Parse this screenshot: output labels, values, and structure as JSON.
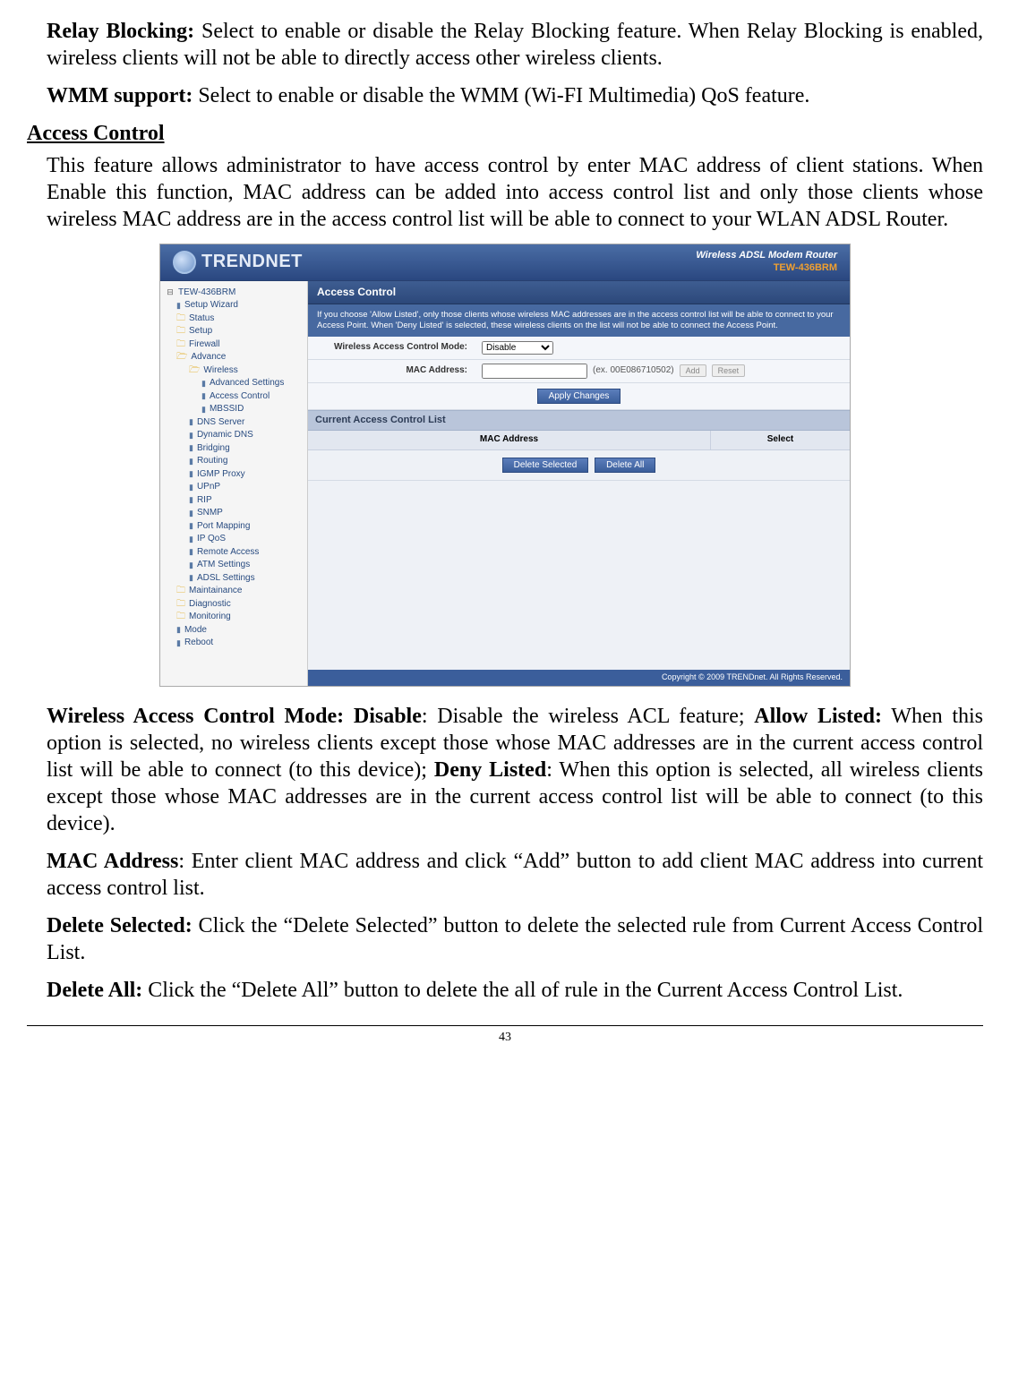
{
  "paragraphs": {
    "relay_label": "Relay Blocking:",
    "relay_text": " Select to enable or disable the Relay Blocking feature. When Relay Blocking is enabled, wireless clients will not be able to directly access other wireless clients.",
    "wmm_label": "WMM support:",
    "wmm_text": " Select to enable or disable the WMM (Wi-FI Multimedia) QoS feature.",
    "section_heading": "Access Control",
    "ac_intro": "This feature allows administrator to have access control by enter MAC address of client stations. When Enable this function, MAC address can be added into access control list and only those clients whose wireless MAC address are in the access control list will be able to connect to your WLAN ADSL Router.",
    "mode_label1": "Wireless Access Control Mode: Disable",
    "mode_text1": ": Disable the wireless ACL feature; ",
    "mode_label2": "Allow Listed:",
    "mode_text2": " When this option is selected, no wireless clients except those whose MAC addresses are in the current access control list will be able to connect (to this device); ",
    "mode_label3": "Deny Listed",
    "mode_text3": ": When this option is selected, all wireless clients except those whose MAC addresses are in the current access control list will be able to connect (to this device).",
    "maca_label": "MAC Address",
    "maca_text": ": Enter client MAC address and click “Add” button to add client MAC address into current access control list.",
    "ds_label": "Delete Selected:",
    "ds_text": " Click the “Delete Selected” button to delete the selected rule from Current Access Control List.",
    "da_label": "Delete All:",
    "da_text": " Click the “Delete All” button to delete the all of rule in the Current Access Control List."
  },
  "page_number": "43",
  "panel": {
    "brand": "TRENDNET",
    "product_line": "Wireless ADSL Modem Router",
    "model": "TEW-436BRM",
    "nav_root_label": "TEW-436BRM",
    "nav": {
      "setup_wizard": "Setup Wizard",
      "status": "Status",
      "setup": "Setup",
      "firewall": "Firewall",
      "advance": "Advance",
      "wireless": "Wireless",
      "adv_settings": "Advanced Settings",
      "access_control": "Access Control",
      "mbssid": "MBSSID",
      "dns_server": "DNS Server",
      "dynamic_dns": "Dynamic DNS",
      "bridging": "Bridging",
      "routing": "Routing",
      "igmp_proxy": "IGMP Proxy",
      "upnp": "UPnP",
      "rip": "RIP",
      "snmp": "SNMP",
      "port_mapping": "Port Mapping",
      "ip_qos": "IP QoS",
      "remote_access": "Remote Access",
      "atm_settings": "ATM Settings",
      "adsl_settings": "ADSL Settings",
      "maintainance": "Maintainance",
      "diagnostic": "Diagnostic",
      "monitoring": "Monitoring",
      "mode": "Mode",
      "reboot": "Reboot"
    },
    "main": {
      "title": "Access Control",
      "info": "If you choose 'Allow Listed', only those clients whose wireless MAC addresses are in the access control list will be able to connect to your Access Point. When 'Deny Listed' is selected, these wireless clients on the list will not be able to connect the Access Point.",
      "mode_label": "Wireless Access Control Mode:",
      "mode_value": "Disable",
      "mac_label": "MAC Address:",
      "mac_example": "(ex. 00E086710502)",
      "btn_add": "Add",
      "btn_reset": "Reset",
      "btn_apply": "Apply Changes",
      "list_title": "Current Access Control List",
      "col_mac": "MAC Address",
      "col_select": "Select",
      "btn_del_sel": "Delete Selected",
      "btn_del_all": "Delete All",
      "copyright": "Copyright © 2009 TRENDnet. All Rights Reserved."
    }
  }
}
